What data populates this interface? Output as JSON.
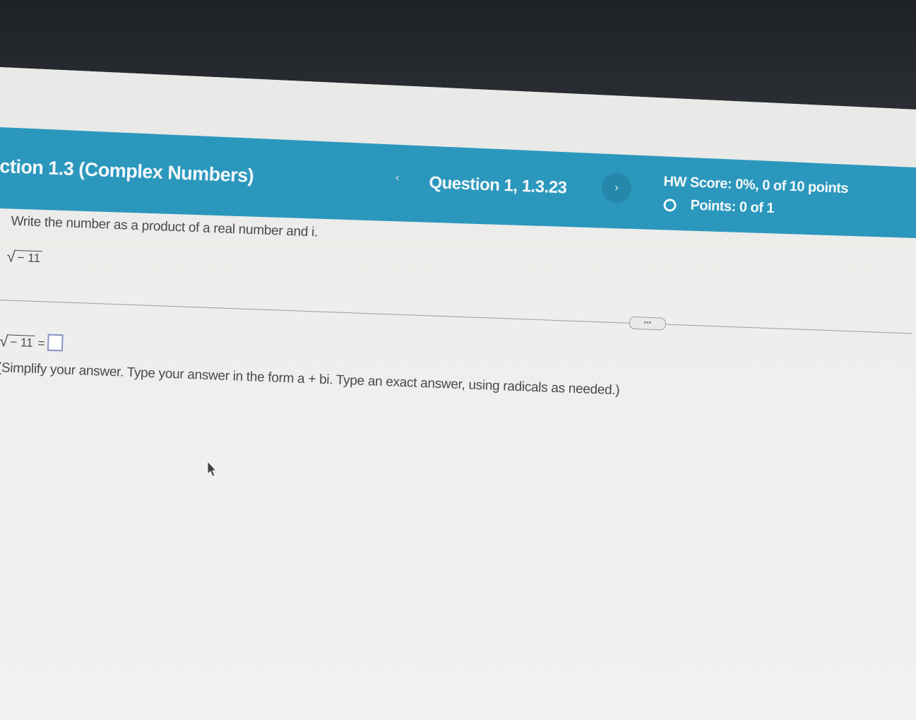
{
  "header": {
    "section_title": "ction 1.3 (Complex Numbers)",
    "prev_icon": "chevron-left-icon",
    "prev_glyph": "‹",
    "question_label": "Question 1, 1.3.23",
    "next_icon": "chevron-right-icon",
    "next_glyph": "›",
    "hw_score": "HW Score: 0%, 0 of 10 points",
    "points": "Points: 0 of 1"
  },
  "question": {
    "instruction": "Write the number as a product of a real number and i.",
    "radical_sign": "√",
    "radicand": "− 11",
    "more_glyph": "•••"
  },
  "answer": {
    "radical_sign": "√",
    "radicand": "− 11",
    "equals": "=",
    "value": "",
    "hint": "(Simplify your answer. Type your answer in the form a + bi. Type an exact answer, using radicals as needed.)"
  },
  "colors": {
    "header_bg": "#2b97bd",
    "answer_box_border": "#8a91c7"
  }
}
